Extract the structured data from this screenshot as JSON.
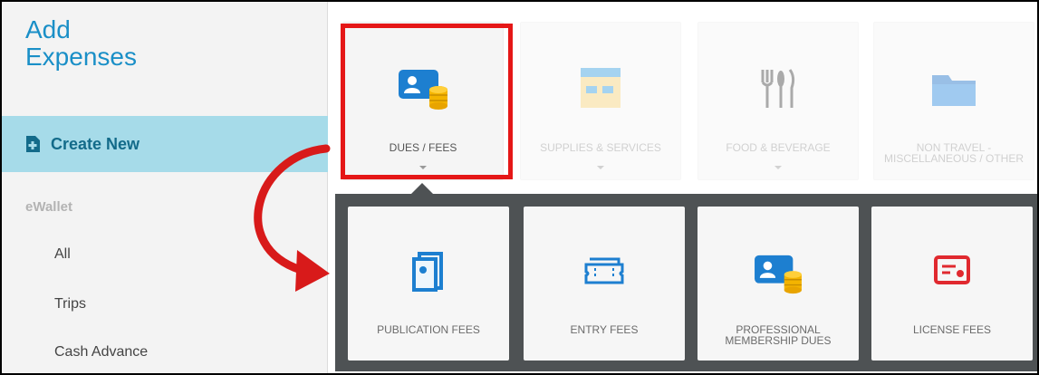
{
  "sidebar": {
    "title_line1": "Add",
    "title_line2": "Expenses",
    "create_new": "Create New",
    "section": "eWallet",
    "items": [
      {
        "label": "All"
      },
      {
        "label": "Trips"
      },
      {
        "label": "Cash Advance"
      }
    ]
  },
  "categories": [
    {
      "label": "DUES / FEES",
      "icon": "id-card-coins-icon",
      "selected": true
    },
    {
      "label": "SUPPLIES & SERVICES",
      "icon": "store-icon"
    },
    {
      "label": "FOOD & BEVERAGE",
      "icon": "utensils-icon"
    },
    {
      "label": "NON TRAVEL - MISCELLANEOUS / OTHER",
      "icon": "folder-icon"
    }
  ],
  "subcategories": [
    {
      "label": "PUBLICATION FEES",
      "icon": "publication-icon"
    },
    {
      "label": "ENTRY FEES",
      "icon": "ticket-icon"
    },
    {
      "label": "PROFESSIONAL MEMBERSHIP DUES",
      "icon": "id-card-coins-icon"
    },
    {
      "label": "LICENSE FEES",
      "icon": "license-certificate-icon"
    }
  ],
  "colors": {
    "accent_blue": "#1a8fc7",
    "highlight_red": "#e51717",
    "panel_dark": "#4e5254",
    "selected_row": "#a6dbe9"
  }
}
